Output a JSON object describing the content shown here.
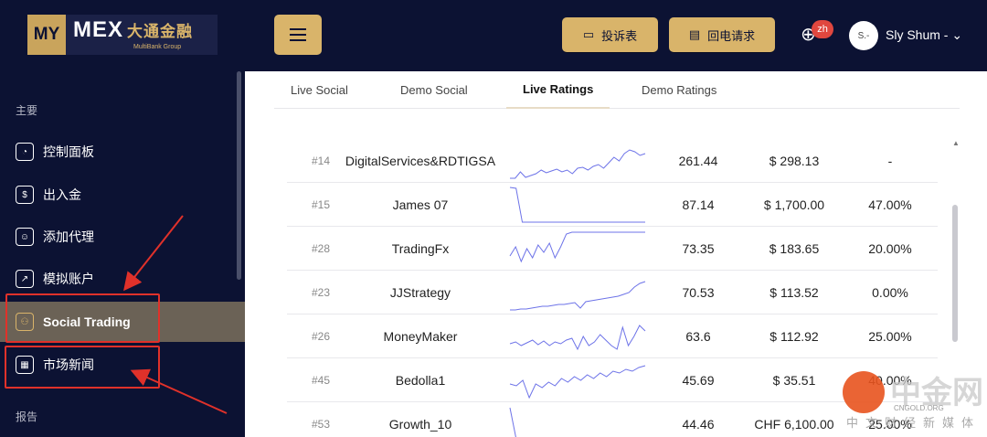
{
  "header": {
    "logo_my": "MY",
    "logo_mex": "MEX",
    "logo_cn": "大通金融",
    "logo_sub": "MultiBank Group",
    "complaint_label": "投诉表",
    "callback_label": "回电请求",
    "lang_badge": "zh",
    "avatar_text": "S.-",
    "username": "Sly Shum - ⌄"
  },
  "sidebar": {
    "section_main": "主要",
    "items": [
      {
        "label": "控制面板"
      },
      {
        "label": "出入金"
      },
      {
        "label": "添加代理"
      },
      {
        "label": "模拟账户"
      },
      {
        "label": "Social Trading"
      },
      {
        "label": "市场新闻"
      }
    ],
    "section_reports": "报告"
  },
  "tabs": [
    "Live Social",
    "Demo Social",
    "Live Ratings",
    "Demo Ratings"
  ],
  "active_tab": "Live Ratings",
  "rows": [
    {
      "rank": "#14",
      "name": "DigitalServices&RDTIGSA",
      "score": "261.44",
      "balance": "$ 298.13",
      "pct": "-",
      "spark": [
        40,
        40,
        32,
        38,
        36,
        34,
        30,
        33,
        31,
        29,
        32,
        30,
        34,
        28,
        27,
        30,
        26,
        24,
        28,
        22,
        16,
        20,
        12,
        8,
        10,
        14,
        12
      ]
    },
    {
      "rank": "#15",
      "name": "James 07",
      "score": "87.14",
      "balance": "$ 1,700.00",
      "pct": "47.00%",
      "spark": [
        0,
        2,
        40,
        40,
        41,
        41,
        41,
        40,
        41,
        41,
        40,
        41,
        41,
        41,
        41,
        40,
        41,
        41,
        41,
        41,
        41,
        41,
        41
      ]
    },
    {
      "rank": "#28",
      "name": "TradingFx",
      "score": "73.35",
      "balance": "$ 183.65",
      "pct": "20.00%",
      "spark": [
        28,
        18,
        34,
        20,
        30,
        16,
        24,
        14,
        30,
        18,
        4,
        2,
        2,
        2,
        2,
        2,
        2,
        2,
        2,
        2,
        2,
        2,
        2,
        2,
        2
      ]
    },
    {
      "rank": "#23",
      "name": "JJStrategy",
      "score": "70.53",
      "balance": "$ 113.52",
      "pct": "0.00%",
      "spark": [
        40,
        39,
        38,
        38,
        37,
        36,
        35,
        35,
        34,
        33,
        33,
        32,
        31,
        37,
        30,
        29,
        28,
        27,
        26,
        25,
        24,
        22,
        20,
        14,
        10,
        8
      ]
    },
    {
      "rank": "#26",
      "name": "MoneyMaker",
      "score": "63.6",
      "balance": "$ 112.92",
      "pct": "25.00%",
      "spark": [
        28,
        26,
        30,
        27,
        24,
        29,
        25,
        30,
        26,
        28,
        24,
        22,
        34,
        20,
        30,
        26,
        18,
        24,
        30,
        34,
        10,
        30,
        20,
        8,
        14
      ]
    },
    {
      "rank": "#45",
      "name": "Bedolla1",
      "score": "45.69",
      "balance": "$ 35.51",
      "pct": "40.00%",
      "spark": [
        24,
        26,
        20,
        40,
        24,
        28,
        22,
        26,
        18,
        22,
        16,
        20,
        14,
        18,
        12,
        16,
        10,
        12,
        8,
        10,
        6,
        4
      ]
    },
    {
      "rank": "#53",
      "name": "Growth_10",
      "score": "44.46",
      "balance": "CHF 6,100.00",
      "pct": "25.00%",
      "spark": [
        2,
        40,
        40,
        40,
        40,
        40,
        40,
        40,
        40,
        40,
        40,
        40,
        40,
        40,
        40,
        40,
        40,
        40,
        40,
        40,
        40
      ]
    }
  ],
  "watermark": {
    "main": "中金网",
    "en": "CNGOLD.ORG",
    "sub": "中文财经新媒体"
  },
  "colors": {
    "navy": "#0c1233",
    "gold": "#d9b46a",
    "active_item": "#6b6256",
    "annotation_red": "#e0312a",
    "spark_line": "#6d73e8"
  }
}
